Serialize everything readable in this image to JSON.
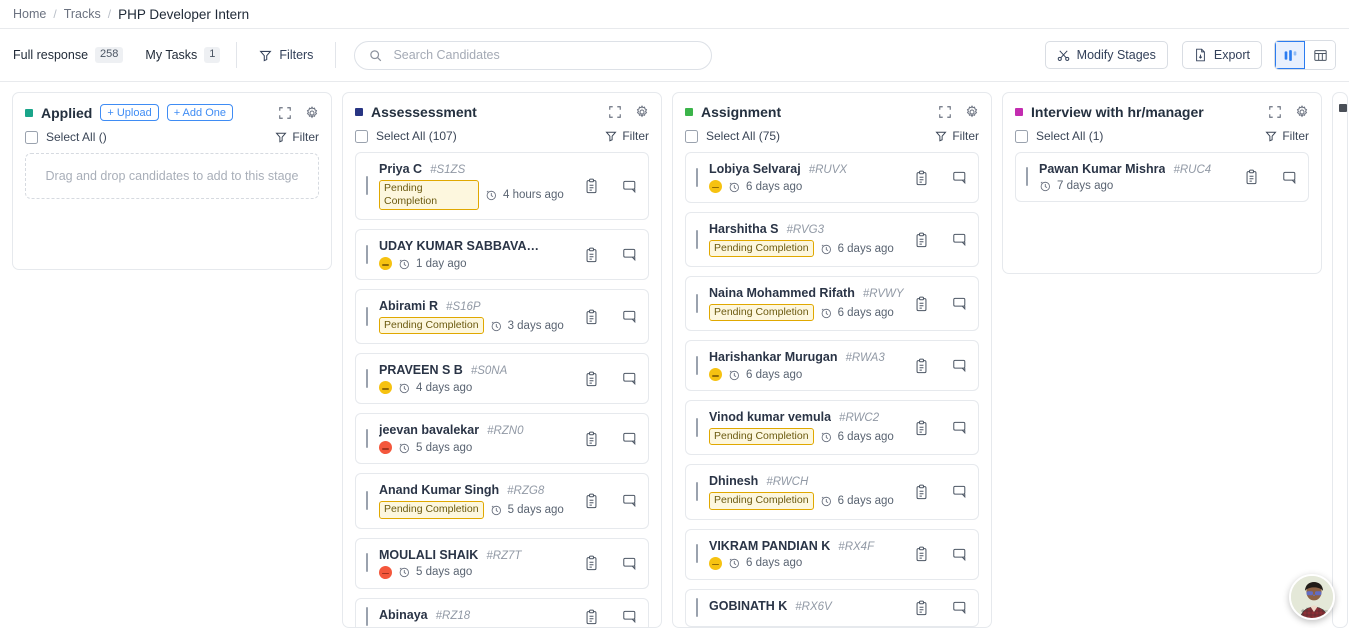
{
  "breadcrumb": {
    "items": [
      "Home",
      "Tracks",
      "PHP Developer Intern"
    ],
    "separator": "/"
  },
  "toolbar": {
    "tabs": [
      {
        "label": "Full response",
        "count": "258"
      },
      {
        "label": "My Tasks",
        "count": "1"
      }
    ],
    "filters_label": "Filters",
    "search": {
      "value": "",
      "placeholder": "Search Candidates"
    },
    "modify_stages_label": "Modify Stages",
    "export_label": "Export",
    "views": [
      {
        "name": "kanban-view",
        "active": true
      },
      {
        "name": "table-view",
        "active": false
      }
    ]
  },
  "board": {
    "filter_label": "Filter",
    "columns": [
      {
        "title": "Applied",
        "dot_color": "#1aa58a",
        "select_all_label": "Select All ()",
        "buttons": [
          {
            "label": "+ Upload",
            "name": "upload-button"
          },
          {
            "label": "+ Add One",
            "name": "add-one-button"
          }
        ],
        "empty_text": "Drag and drop candidates to add to this stage",
        "cards": []
      },
      {
        "title": "Assessessment",
        "dot_color": "#283583",
        "select_all_label": "Select All (107)",
        "buttons": [],
        "cards": [
          {
            "name": "Priya C",
            "id": "#S1ZS",
            "badge": "Pending Completion",
            "badge_wrap": true,
            "time": "4 hours ago",
            "time_wrap": true,
            "mood": null
          },
          {
            "name": "UDAY KUMAR SABBAVARAPU ...",
            "id": "",
            "badge": null,
            "time": "1 day ago",
            "mood": "neutral"
          },
          {
            "name": "Abirami R",
            "id": "#S16P",
            "badge": "Pending Completion",
            "time": "3 days ago",
            "mood": null
          },
          {
            "name": "PRAVEEN S B",
            "id": "#S0NA",
            "badge": null,
            "time": "4 days ago",
            "mood": "neutral"
          },
          {
            "name": "jeevan bavalekar",
            "id": "#RZN0",
            "badge": null,
            "time": "5 days ago",
            "mood": "sad"
          },
          {
            "name": "Anand Kumar Singh",
            "id": "#RZG8",
            "badge": "Pending Completion",
            "time": "5 days ago",
            "mood": null
          },
          {
            "name": "MOULALI SHAIK",
            "id": "#RZ7T",
            "badge": null,
            "time": "5 days ago",
            "mood": "sad"
          },
          {
            "name": "Abinaya",
            "id": "#RZ18",
            "badge": null,
            "time": "",
            "mood": null
          }
        ]
      },
      {
        "title": "Assignment",
        "dot_color": "#3bb44a",
        "select_all_label": "Select All (75)",
        "buttons": [],
        "cards": [
          {
            "name": "Lobiya Selvaraj",
            "id": "#RUVX",
            "badge": null,
            "time": "6 days ago",
            "mood": "neutral"
          },
          {
            "name": "Harshitha S",
            "id": "#RVG3",
            "badge": "Pending Completion",
            "time": "6 days ago",
            "mood": null
          },
          {
            "name": "Naina Mohammed Rifath",
            "id": "#RVWY",
            "badge": "Pending Completion",
            "time": "6 days ago",
            "mood": null
          },
          {
            "name": "Harishankar Murugan",
            "id": "#RWA3",
            "badge": null,
            "time": "6 days ago",
            "mood": "neutral"
          },
          {
            "name": "Vinod kumar vemula",
            "id": "#RWC2",
            "badge": "Pending Completion",
            "time": "6 days ago",
            "mood": null
          },
          {
            "name": "Dhinesh",
            "id": "#RWCH",
            "badge": "Pending Completion",
            "time": "6 days ago",
            "mood": null
          },
          {
            "name": "VIKRAM PANDIAN K",
            "id": "#RX4F",
            "badge": null,
            "time": "6 days ago",
            "mood": "neutral"
          },
          {
            "name": "GOBINATH K",
            "id": "#RX6V",
            "badge": null,
            "time": "",
            "mood": null
          }
        ]
      },
      {
        "title": "Interview with hr/manager",
        "dot_color": "#c32cb0",
        "select_all_label": "Select All (1)",
        "buttons": [],
        "cards": [
          {
            "name": "Pawan Kumar Mishra",
            "id": "#RUC4",
            "badge": null,
            "time": "7 days ago",
            "mood": null
          }
        ]
      }
    ]
  },
  "icons": {
    "search": "search-icon",
    "filter": "filter-icon",
    "expand": "expand-icon",
    "settings": "gear-icon",
    "notes": "clipboard-icon",
    "comment": "chat-icon",
    "clock": "clock-icon"
  }
}
